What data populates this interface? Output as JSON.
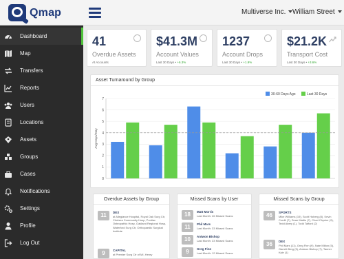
{
  "app": {
    "brand": "Qmap"
  },
  "topbar": {
    "company": "Multiverse Inc.",
    "location": "William Street"
  },
  "sidebar": {
    "items": [
      {
        "label": "Dashboard",
        "icon": "dashboard-icon",
        "active": true
      },
      {
        "label": "Map",
        "icon": "map-icon"
      },
      {
        "label": "Transfers",
        "icon": "transfers-icon"
      },
      {
        "label": "Reports",
        "icon": "reports-icon"
      },
      {
        "label": "Users",
        "icon": "users-icon"
      },
      {
        "label": "Locations",
        "icon": "locations-icon"
      },
      {
        "label": "Assets",
        "icon": "assets-icon"
      },
      {
        "label": "Groups",
        "icon": "groups-icon"
      },
      {
        "label": "Cases",
        "icon": "cases-icon"
      },
      {
        "label": "Notifications",
        "icon": "bell-icon"
      },
      {
        "label": "Settings",
        "icon": "gear-icon"
      },
      {
        "label": "Profile",
        "icon": "user-icon"
      },
      {
        "label": "Log Out",
        "icon": "logout-icon"
      }
    ]
  },
  "stats": [
    {
      "value": "41",
      "label": "Overdue Assets",
      "sub": "At Accounts",
      "change": "",
      "icon": "clock-icon"
    },
    {
      "value": "$41.3M",
      "label": "Account Values",
      "sub": "Last 30 Days",
      "change": "+6.3%",
      "icon": "clock-icon"
    },
    {
      "value": "1237",
      "label": "Account Drops",
      "sub": "Last 30 Days",
      "change": "+1.9%",
      "icon": "clock-icon"
    },
    {
      "value": "$21.2K",
      "label": "Transport Cost",
      "sub": "Last 30 Days",
      "change": "+3.6%",
      "icon": "trend-icon"
    }
  ],
  "chart": {
    "title": "Asset Turnaround by Group"
  },
  "chart_data": {
    "type": "bar",
    "title": "Asset Turnaround by Group",
    "ylabel": "Avg Days/Stay",
    "xlabel": "",
    "ylim": [
      0,
      7
    ],
    "yticks": [
      0,
      1,
      2,
      3,
      4,
      5,
      6,
      7
    ],
    "categories": [
      "",
      "",
      "",
      "",
      "",
      ""
    ],
    "series": [
      {
        "name": "30-60 Days Ago",
        "color": "#4f8de8",
        "values": [
          3.2,
          2.9,
          6.3,
          2.2,
          2.8,
          4.0
        ]
      },
      {
        "name": "Last 30 Days",
        "color": "#65cf4a",
        "values": [
          4.9,
          4.7,
          4.9,
          3.7,
          4.7,
          5.7
        ]
      }
    ],
    "reference_line": 4.0,
    "legend": "top-right"
  },
  "lists": [
    {
      "title": "Overdue Assets by Group",
      "items": [
        {
          "num": "11",
          "name": "DEX",
          "detail": "at Allegiance Hospital, Royal Oak Surg Ctr, Chelsea Community Hosp, Pontiac Osteopathic Hosp, Oakland Regional Hosp, Waterford Surg Ctr, Orthopaedic Surgical Institute"
        },
        {
          "num": "9",
          "name": "CAPITAL",
          "detail": "at Premier Surg Ctr of MI, Henry"
        }
      ]
    },
    {
      "title": "Missed Scans by User",
      "items": [
        {
          "num": "18",
          "name": "Matt Morris",
          "detail": "Last Month: 26 Missed Scans"
        },
        {
          "num": "11",
          "name": "Phil Mars",
          "detail": "Last Month: 33 Missed Scans"
        },
        {
          "num": "10",
          "name": "Antwon Bishop",
          "detail": "Last Month: 33 Missed Scans"
        },
        {
          "num": "9",
          "name": "Greg Finn",
          "detail": "Last Month: 12 Missed Scans"
        }
      ]
    },
    {
      "title": "Missed Scans by Group",
      "items": [
        {
          "num": "46",
          "name": "SPORTS",
          "detail": "Mike Williams (19), Scott Hoberg (8), Kevin Credit (7), Sean Mattis (7), Charl Chynier (9), Tedd Abery (1), Todd Talford (2)"
        },
        {
          "num": "36",
          "name": "DEX",
          "detail": "Phil Mars (11), Greg Finn (9), Nate Milton (5), Garrett Berg (5), Antwon Bishop (7), Tanner Kyle (1)"
        }
      ]
    }
  ]
}
